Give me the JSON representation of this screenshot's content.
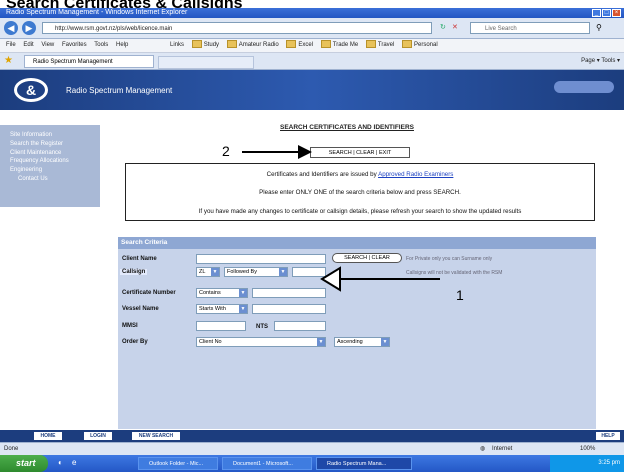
{
  "top_heading": "Search Certificates & Callsigns",
  "window": {
    "title": "Radio Spectrum Management - Windows Internet Explorer",
    "address": "http://www.rsm.govt.nz/pls/web/licence.main",
    "search_placeholder": "Live Search"
  },
  "menu": {
    "items": [
      "File",
      "Edit",
      "View",
      "Favorites",
      "Tools",
      "Help"
    ],
    "links": [
      "Links",
      "Study",
      "Amateur Radio",
      "Excel",
      "Trade Me",
      "Travel",
      "Personal"
    ]
  },
  "tab": {
    "label": "Radio Spectrum Management",
    "tools": "Page ▾  Tools ▾"
  },
  "site": {
    "title": "Radio Spectrum Management",
    "logo_glyph": "&"
  },
  "sidebar": {
    "items": [
      {
        "label": "Site Information"
      },
      {
        "label": "Search the Register"
      },
      {
        "label": "Client Maintenance"
      },
      {
        "label": "Frequency Allocations"
      },
      {
        "label": "Engineering"
      },
      {
        "label": "Contact Us"
      }
    ]
  },
  "main": {
    "title": "SEARCH CERTIFICATES AND IDENTIFIERS",
    "top_buttons": "SEARCH | CLEAR | EXIT",
    "info": {
      "line1_prefix": "Certificates and Identifiers are issued by",
      "line1_link": "Approved Radio Examiners",
      "line2": "Please enter ONLY ONE of the search criteria below and press SEARCH.",
      "line3": "If you have made any changes to certificate or callsign details, please refresh your search to show the updated results"
    }
  },
  "form": {
    "header": "Search Criteria",
    "client_name_label": "Client Name",
    "callsign_label": "Callsign",
    "callsign_prefix": "ZL",
    "callsign_mode": "Followed By",
    "cert_number_label": "Certificate Number",
    "cert_number_mode": "Contains",
    "vessel_name_label": "Vessel Name",
    "vessel_name_mode": "Starts With",
    "mmsi_label": "MMSI",
    "ntd_label": "NTS",
    "order_by_label": "Order By",
    "order_by_value": "Client No",
    "order_dir": "Ascending",
    "inline_buttons": "SEARCH | CLEAR",
    "hint1": "For Private only you can Surname only",
    "hint2": "Callsigns will not be validated with the RSM"
  },
  "annotations": {
    "label_1": "1",
    "label_2": "2"
  },
  "bottom": {
    "links": [
      "HOME",
      "LOGIN",
      "NEW SEARCH",
      "HELP"
    ]
  },
  "status": {
    "left": "Done",
    "zone": "Internet",
    "zoom": "100%"
  },
  "taskbar": {
    "start": "start",
    "items": [
      "Outlook Folder - Mic...",
      "Document1 - Microsoft...",
      "Radio Spectrum Mana..."
    ],
    "time": "3:25 pm"
  },
  "colors": {
    "header_blue": "#1c3d7e",
    "form_blue": "#c7d3ea",
    "link_blue": "#1a3fc0"
  }
}
